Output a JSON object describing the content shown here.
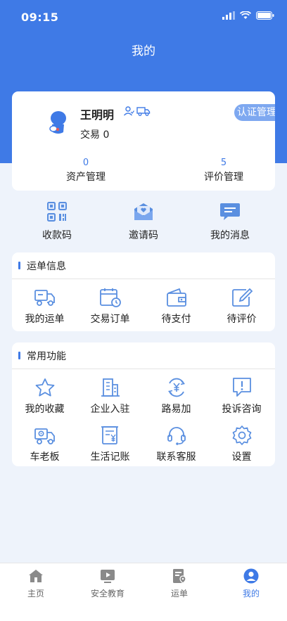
{
  "status": {
    "time": "09:15"
  },
  "header": {
    "title": "我的"
  },
  "profile": {
    "name": "王明明",
    "trade_label": "交易",
    "trade_count": "0",
    "cert_button": "认证管理",
    "stats": [
      {
        "value": "0",
        "label": "资产管理"
      },
      {
        "value": "5",
        "label": "评价管理"
      }
    ]
  },
  "quick": [
    {
      "label": "收款码",
      "icon": "qrcode-icon"
    },
    {
      "label": "邀请码",
      "icon": "invite-icon"
    },
    {
      "label": "我的消息",
      "icon": "message-icon"
    }
  ],
  "waybill": {
    "title": "运单信息",
    "items": [
      {
        "label": "我的运单",
        "icon": "truck-icon"
      },
      {
        "label": "交易订单",
        "icon": "calendar-clock-icon"
      },
      {
        "label": "待支付",
        "icon": "wallet-icon"
      },
      {
        "label": "待评价",
        "icon": "edit-icon"
      }
    ]
  },
  "common": {
    "title": "常用功能",
    "items": [
      {
        "label": "我的收藏",
        "icon": "star-icon"
      },
      {
        "label": "企业入驻",
        "icon": "building-icon"
      },
      {
        "label": "路易加",
        "icon": "yen-cycle-icon"
      },
      {
        "label": "投诉咨询",
        "icon": "alert-message-icon"
      },
      {
        "label": "车老板",
        "icon": "truck-gear-icon"
      },
      {
        "label": "生活记账",
        "icon": "ledger-icon"
      },
      {
        "label": "联系客服",
        "icon": "headset-icon"
      },
      {
        "label": "设置",
        "icon": "gear-icon"
      }
    ]
  },
  "tabs": [
    {
      "label": "主页",
      "icon": "home-icon",
      "active": false
    },
    {
      "label": "安全教育",
      "icon": "video-icon",
      "active": false
    },
    {
      "label": "运单",
      "icon": "waybill-icon",
      "active": false
    },
    {
      "label": "我的",
      "icon": "user-icon",
      "active": true
    }
  ],
  "colors": {
    "brand": "#3f7ae6",
    "background": "#eef3fb",
    "icon": "#5a8fe0"
  }
}
